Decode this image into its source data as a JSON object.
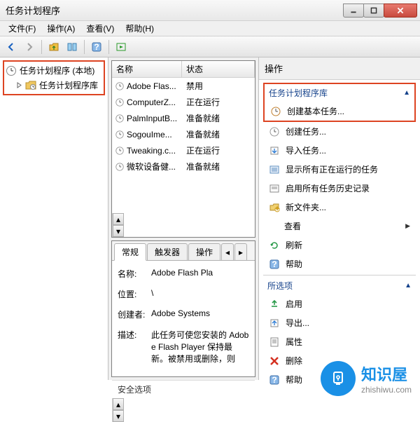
{
  "window": {
    "title": "任务计划程序"
  },
  "menu": {
    "file": "文件(F)",
    "action": "操作(A)",
    "view": "查看(V)",
    "help": "帮助(H)"
  },
  "tree": {
    "root": "任务计划程序 (本地)",
    "library": "任务计划程序库"
  },
  "list": {
    "columns": {
      "name": "名称",
      "status": "状态"
    },
    "rows": [
      {
        "name": "Adobe Flas...",
        "status": "禁用"
      },
      {
        "name": "ComputerZ...",
        "status": "正在运行"
      },
      {
        "name": "PalmInputB...",
        "status": "准备就绪"
      },
      {
        "name": "SogouIme...",
        "status": "准备就绪"
      },
      {
        "name": "Tweaking.c...",
        "status": "正在运行"
      },
      {
        "name": "微软设备健...",
        "status": "准备就绪"
      }
    ]
  },
  "details": {
    "tabs": {
      "general": "常规",
      "triggers": "触发器",
      "actions": "操作"
    },
    "name_label": "名称:",
    "name_value": "Adobe Flash Pla",
    "location_label": "位置:",
    "location_value": "\\",
    "author_label": "创建者:",
    "author_value": "Adobe Systems",
    "desc_label": "描述:",
    "desc_value": "此任务可使您安装的 Adobe Flash Player 保持最新。被禁用或删除，则",
    "security_heading": "安全选项"
  },
  "actions": {
    "header": "操作",
    "section_library": "任务计划程序库",
    "create_basic": "创建基本任务...",
    "create": "创建任务...",
    "import": "导入任务...",
    "show_running": "显示所有正在运行的任务",
    "enable_history": "启用所有任务历史记录",
    "new_folder": "新文件夹...",
    "view": "查看",
    "refresh": "刷新",
    "help": "帮助",
    "section_selected": "所选项",
    "enable": "启用",
    "export": "导出...",
    "properties": "属性",
    "delete": "删除",
    "help2": "帮助"
  },
  "watermark": {
    "brand": "知识屋",
    "url": "zhishiwu.com"
  }
}
